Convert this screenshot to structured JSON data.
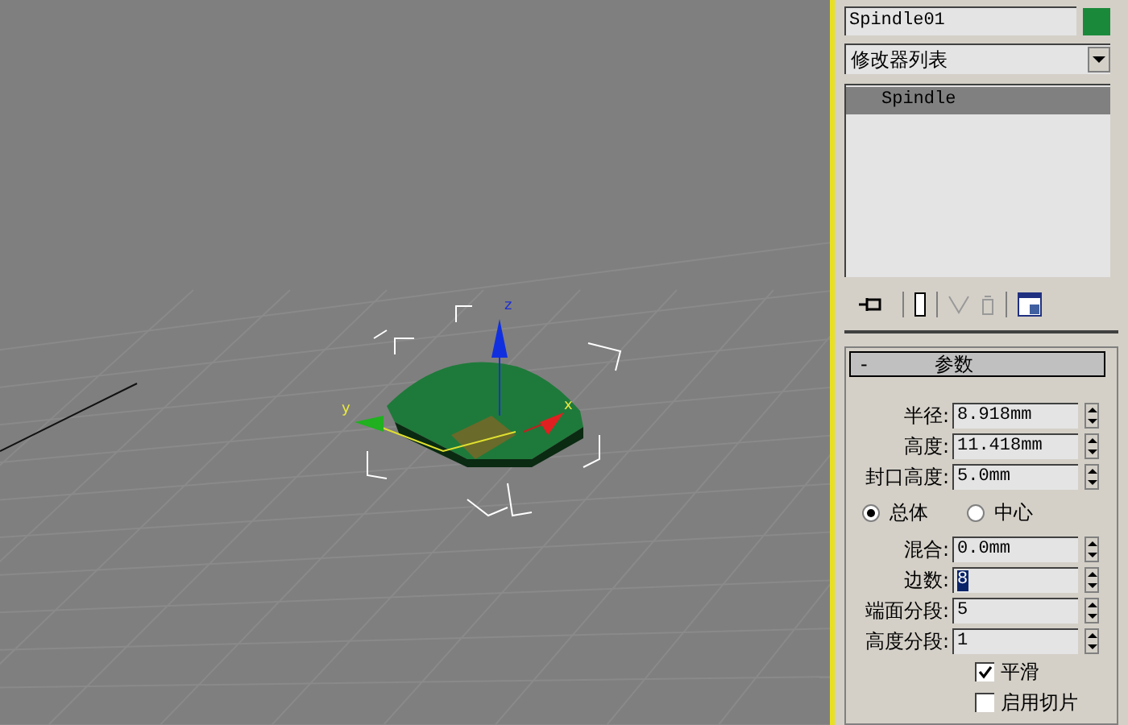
{
  "viewport": {
    "axes": [
      {
        "label": "x"
      },
      {
        "label": "y"
      },
      {
        "label": "z"
      }
    ]
  },
  "panel": {
    "object_name": "Spindle01",
    "modifier_list": "修改器列表",
    "stack": [
      {
        "label": "Spindle",
        "selected": true
      }
    ],
    "rollout": {
      "toggle": "-",
      "title": "参数",
      "expanded": true,
      "rows": [
        {
          "kind": "spinner",
          "label": "半径:",
          "value": "8.918mm",
          "highlighted": false
        },
        {
          "kind": "spinner",
          "label": "高度:",
          "value": "11.418mm",
          "highlighted": false
        },
        {
          "kind": "spinner",
          "label": "封口高度:",
          "value": "5.0mm",
          "highlighted": false
        },
        {
          "kind": "radios",
          "options": [
            {
              "label": "总体",
              "selected": true
            },
            {
              "label": "中心",
              "selected": false
            }
          ]
        },
        {
          "kind": "spinner",
          "label": "混合:",
          "value": "0.0mm",
          "highlighted": false
        },
        {
          "kind": "spinner",
          "label": "边数:",
          "value": "8",
          "highlighted": true
        },
        {
          "kind": "spinner",
          "label": "端面分段:",
          "value": "5",
          "highlighted": false
        },
        {
          "kind": "spinner",
          "label": "高度分段:",
          "value": "1",
          "highlighted": false
        },
        {
          "kind": "checkbox",
          "label": "平滑",
          "checked": true
        },
        {
          "kind": "checkbox",
          "label": "启用切片",
          "checked": false
        }
      ]
    }
  }
}
